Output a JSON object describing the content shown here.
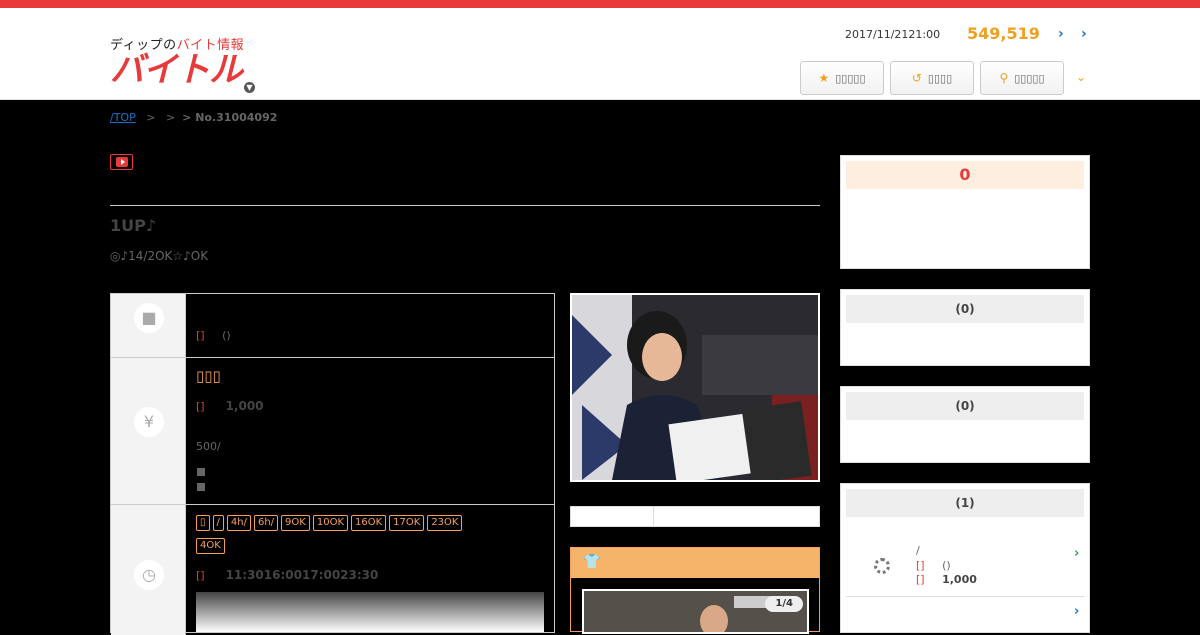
{
  "header": {
    "logo_small_prefix": "ディップの",
    "logo_small_red": "バイト情報",
    "logo_big": "バイトル",
    "datetime": "2017/11/2121:00",
    "count": "549,519",
    "buttons": {
      "favorites": "",
      "history": "",
      "search": ""
    },
    "arrow1": "›",
    "arrow2": "›"
  },
  "breadcrumb": {
    "top": "/TOP",
    "sep1": ">",
    "sep2": ">",
    "current": "> No.31004092"
  },
  "job": {
    "title": "1UP♪",
    "subtitle": "◎♪14/2OK☆♪OK"
  },
  "rows": {
    "job_type": {
      "bracket": "[]",
      "text": "()"
    },
    "salary": {
      "chips_text": "▯▯▯",
      "bracket": "[]",
      "amount": "1,000",
      "note": "500/"
    },
    "hours": {
      "chips": [
        "▯",
        "/",
        "4h/",
        "6h/",
        "9OK",
        "10OK",
        "16OK",
        "17OK",
        "23OK",
        "4OK"
      ],
      "bracket": "[]",
      "times": "11:3016:0017:0023:30"
    }
  },
  "gallery": {
    "pager": "1/4"
  },
  "sidebar": {
    "box1": {
      "value": "0"
    },
    "box2": {
      "label": "(0)"
    },
    "box3": {
      "label": "(0)"
    },
    "box4": {
      "label": "(1)",
      "line1": "/",
      "b1": "[]",
      "t1": "()",
      "b2": "[]",
      "t2": "1,000"
    }
  },
  "colors": {
    "accent": "#e83a3a",
    "orange": "#f0a020",
    "link": "#1a73c8"
  }
}
